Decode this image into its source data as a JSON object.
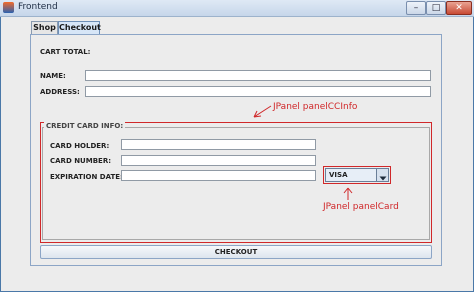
{
  "window": {
    "title": "Frontend",
    "buttons": {
      "minimize": "–",
      "maximize": "□",
      "close": "✕"
    }
  },
  "tabs": [
    {
      "label": "Shop",
      "selected": false
    },
    {
      "label": "Checkout",
      "selected": true
    }
  ],
  "form": {
    "cart_total_label": "CART TOTAL:",
    "name_label": "NAME:",
    "name_value": "",
    "address_label": "ADDRESS:",
    "address_value": ""
  },
  "credit_card": {
    "legend": "CREDIT CARD INFO:",
    "holder_label": "CARD HOLDER:",
    "holder_value": "",
    "number_label": "CARD NUMBER:",
    "number_value": "",
    "expiration_label": "EXPIRATION DATE:",
    "expiration_value": "",
    "card_type_selected": "VISA"
  },
  "annotations": {
    "cc_panel": "JPanel panelCCInfo",
    "card_panel": "JPanel panelCard",
    "color": "#d0282a"
  },
  "checkout_button": "CHECKOUT",
  "icons": {
    "app": "java-app-icon",
    "dropdown": "chevron-down-icon"
  }
}
